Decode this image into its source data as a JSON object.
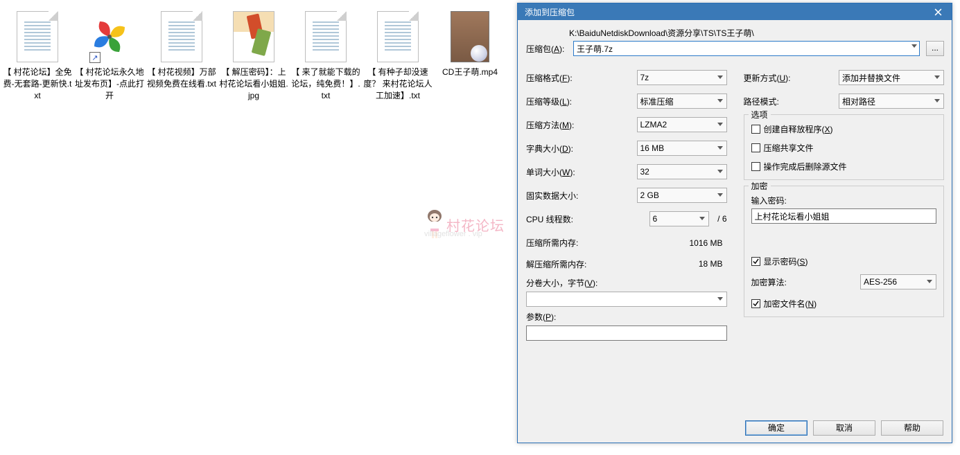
{
  "desktop": {
    "files": [
      {
        "name": "【 村花论坛】全免费-无套路-更新快.txt",
        "type": "txt"
      },
      {
        "name": "【 村花论坛永久地址发布页】-点此打开",
        "type": "shortcut"
      },
      {
        "name": "【 村花视频】万部视频免费在线看.txt",
        "type": "txt"
      },
      {
        "name": "【 解压密码】：上村花论坛看小姐姐.jpg",
        "type": "jpg"
      },
      {
        "name": "【 来了就能下载的论坛，纯免费！】.txt",
        "type": "txt"
      },
      {
        "name": "【 有种子却没速度？ 来村花论坛人工加速】.txt",
        "type": "txt"
      },
      {
        "name": "CD王子萌.mp4",
        "type": "mp4"
      }
    ]
  },
  "watermark": {
    "text": "村花论坛",
    "url": "villageflower . vip"
  },
  "dialog": {
    "title": "添加到压缩包",
    "archive_label": "压缩包(A):",
    "path": "K:\\BaiduNetdiskDownload\\资源分享\\TS\\TS王子萌\\",
    "archive_value": "王子萌.7z",
    "browse": "...",
    "left": {
      "format_label": "压缩格式(F):",
      "format_value": "7z",
      "level_label": "压缩等级(L):",
      "level_value": "标准压缩",
      "method_label": "压缩方法(M):",
      "method_value": "LZMA2",
      "dict_label": "字典大小(D):",
      "dict_value": "16 MB",
      "word_label": "单词大小(W):",
      "word_value": "32",
      "solid_label": "固实数据大小:",
      "solid_value": "2 GB",
      "cpu_label": "CPU 线程数:",
      "cpu_value": "6",
      "cpu_total": "/ 6",
      "mem_compress_label": "压缩所需内存:",
      "mem_compress_value": "1016 MB",
      "mem_decompress_label": "解压缩所需内存:",
      "mem_decompress_value": "18 MB",
      "split_label": "分卷大小，字节(V):",
      "param_label": "参数(P):"
    },
    "right": {
      "update_label": "更新方式(U):",
      "update_value": "添加并替换文件",
      "pathmode_label": "路径模式:",
      "pathmode_value": "相对路径",
      "options_title": "选项",
      "opt_sfx": "创建自释放程序(X)",
      "opt_share": "压缩共享文件",
      "opt_delete": "操作完成后删除源文件",
      "enc_title": "加密",
      "pw_label": "输入密码:",
      "pw_value": "上村花论坛看小姐姐",
      "show_pw": "显示密码(S)",
      "algo_label": "加密算法:",
      "algo_value": "AES-256",
      "enc_names": "加密文件名(N)"
    },
    "buttons": {
      "ok": "确定",
      "cancel": "取消",
      "help": "帮助"
    }
  }
}
